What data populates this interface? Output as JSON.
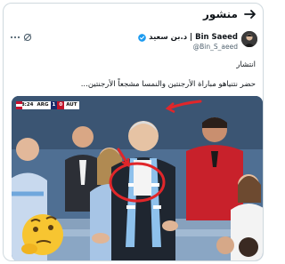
{
  "header": {
    "title": "منشور",
    "back_icon": "arrow-right-icon"
  },
  "author": {
    "name": "د.بن سعيد | Bin Saeed",
    "handle": "@Bin_S_aeed",
    "verified_icon": "verified-badge-icon",
    "avatar_icon": "avatar-image"
  },
  "actions": {
    "more_icon": "more-dots-icon",
    "grok_icon": "grok-icon"
  },
  "post": {
    "line1": "انتشار",
    "line2": "حضر نتنياهو مباراة الأرجنتين والنمسا مشجعاً الأرجنتين..."
  },
  "scoreboard": {
    "time": "18:24",
    "team1": "ARG",
    "score1": "1",
    "score2": "0",
    "team2": "AUT"
  },
  "colors": {
    "accent": "#1d9bf0",
    "annotation": "#e0262a",
    "border": "#cfd9de"
  }
}
